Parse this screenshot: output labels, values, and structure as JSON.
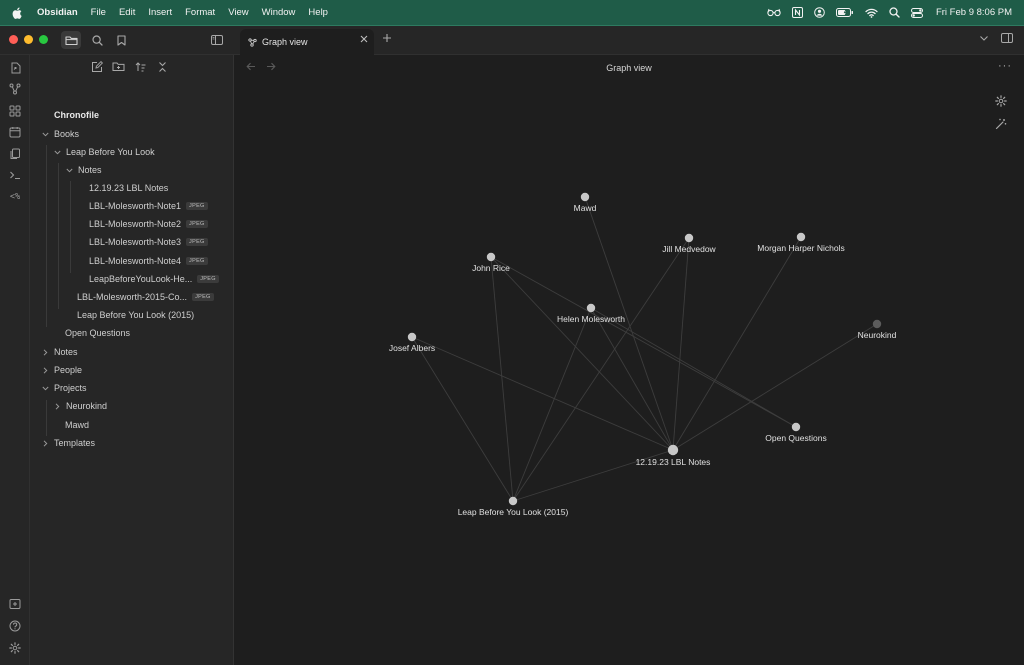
{
  "menubar": {
    "app_name": "Obsidian",
    "menus": [
      "File",
      "Edit",
      "Insert",
      "Format",
      "View",
      "Window",
      "Help"
    ],
    "clock": "Fri Feb 9  8:06 PM",
    "status_icons": [
      "glasses-icon",
      "notion-icon",
      "user-circle-icon",
      "battery-icon",
      "wifi-icon",
      "search-icon",
      "control-center-icon"
    ]
  },
  "tabs": [
    {
      "label": "Graph view",
      "icon": "graph-icon",
      "active": true
    }
  ],
  "sidebar": {
    "vault_name": "Chronofile",
    "tree": [
      {
        "label": "Books",
        "type": "folder",
        "expanded": true,
        "depth": 0
      },
      {
        "label": "Leap Before You Look",
        "type": "folder",
        "expanded": true,
        "depth": 1
      },
      {
        "label": "Notes",
        "type": "folder",
        "expanded": true,
        "depth": 2
      },
      {
        "label": "12.19.23 LBL Notes",
        "type": "file",
        "depth": 3,
        "badge": ""
      },
      {
        "label": "LBL-Molesworth-Note1",
        "type": "file",
        "depth": 3,
        "badge": "JPEG"
      },
      {
        "label": "LBL-Molesworth-Note2",
        "type": "file",
        "depth": 3,
        "badge": "JPEG"
      },
      {
        "label": "LBL-Molesworth-Note3",
        "type": "file",
        "depth": 3,
        "badge": "JPEG"
      },
      {
        "label": "LBL-Molesworth-Note4",
        "type": "file",
        "depth": 3,
        "badge": "JPEG"
      },
      {
        "label": "LeapBeforeYouLook-He...",
        "type": "file",
        "depth": 3,
        "badge": "JPEG"
      },
      {
        "label": "LBL-Molesworth-2015-Co...",
        "type": "file",
        "depth": 2,
        "badge": "JPEG"
      },
      {
        "label": "Leap Before You Look (2015)",
        "type": "file",
        "depth": 2,
        "badge": ""
      },
      {
        "label": "Open Questions",
        "type": "file",
        "depth": 1,
        "badge": ""
      },
      {
        "label": "Notes",
        "type": "folder",
        "expanded": false,
        "depth": 0
      },
      {
        "label": "People",
        "type": "folder",
        "expanded": false,
        "depth": 0
      },
      {
        "label": "Projects",
        "type": "folder",
        "expanded": true,
        "depth": 0
      },
      {
        "label": "Neurokind",
        "type": "folder",
        "expanded": false,
        "depth": 1
      },
      {
        "label": "Mawd",
        "type": "file",
        "depth": 1,
        "badge": ""
      },
      {
        "label": "Templates",
        "type": "folder",
        "expanded": false,
        "depth": 0
      }
    ]
  },
  "main": {
    "title": "Graph view"
  },
  "graph": {
    "nodes": [
      {
        "id": "mawd",
        "label": "Mawd"
      },
      {
        "id": "john",
        "label": "John Rice"
      },
      {
        "id": "jill",
        "label": "Jill Medvedow"
      },
      {
        "id": "morgan",
        "label": "Morgan Harper Nichols"
      },
      {
        "id": "helen",
        "label": "Helen Molesworth"
      },
      {
        "id": "neuro",
        "label": "Neurokind"
      },
      {
        "id": "josef",
        "label": "Josef Albers"
      },
      {
        "id": "openq",
        "label": "Open Questions"
      },
      {
        "id": "lbl",
        "label": "12.19.23 LBL Notes"
      },
      {
        "id": "leap",
        "label": "Leap Before You Look (2015)"
      }
    ],
    "edges": [
      [
        "lbl",
        "mawd"
      ],
      [
        "lbl",
        "john"
      ],
      [
        "lbl",
        "jill"
      ],
      [
        "lbl",
        "morgan"
      ],
      [
        "lbl",
        "helen"
      ],
      [
        "lbl",
        "neuro"
      ],
      [
        "lbl",
        "josef"
      ],
      [
        "lbl",
        "leap"
      ],
      [
        "leap",
        "john"
      ],
      [
        "leap",
        "jill"
      ],
      [
        "leap",
        "helen"
      ],
      [
        "leap",
        "josef"
      ],
      [
        "openq",
        "john"
      ],
      [
        "openq",
        "helen"
      ]
    ]
  }
}
